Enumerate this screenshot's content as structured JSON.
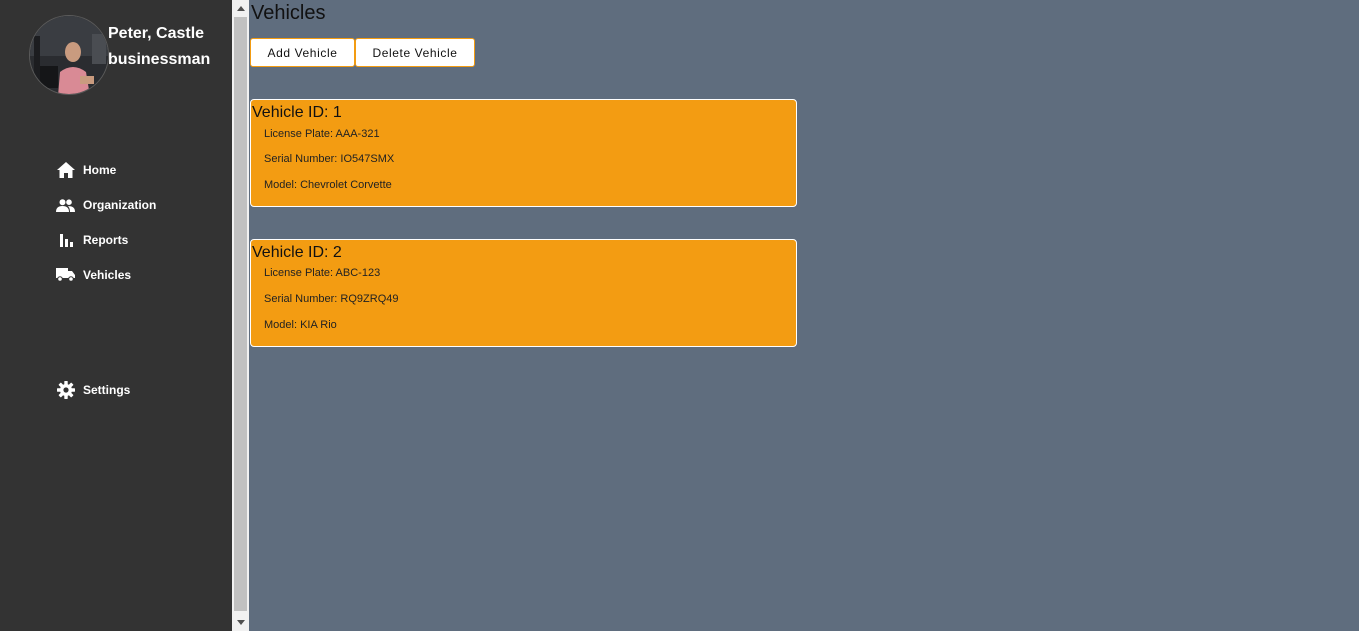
{
  "user": {
    "name": "Peter, Castle",
    "role": "businessman"
  },
  "sidebar": {
    "items": [
      {
        "label": "Home",
        "icon": "home-icon"
      },
      {
        "label": "Organization",
        "icon": "people-icon"
      },
      {
        "label": "Reports",
        "icon": "bar-chart-icon"
      },
      {
        "label": "Vehicles",
        "icon": "truck-icon"
      }
    ],
    "settings": {
      "label": "Settings",
      "icon": "gear-icon"
    }
  },
  "page": {
    "title": "Vehicles"
  },
  "toolbar": {
    "add_label": "Add Vehicle",
    "delete_label": "Delete Vehicle"
  },
  "vehicles": [
    {
      "title": "Vehicle ID: 1",
      "license": "License Plate: AAA-321",
      "serial": "Serial Number: IO547SMX",
      "model": "Model: Chevrolet Corvette"
    },
    {
      "title": "Vehicle ID: 2",
      "license": "License Plate: ABC-123",
      "serial": "Serial Number: RQ9ZRQ49",
      "model": "Model: KIA Rio"
    }
  ],
  "colors": {
    "sidebar_bg": "#333333",
    "main_bg": "#5f6d7e",
    "accent": "#f39c12"
  }
}
